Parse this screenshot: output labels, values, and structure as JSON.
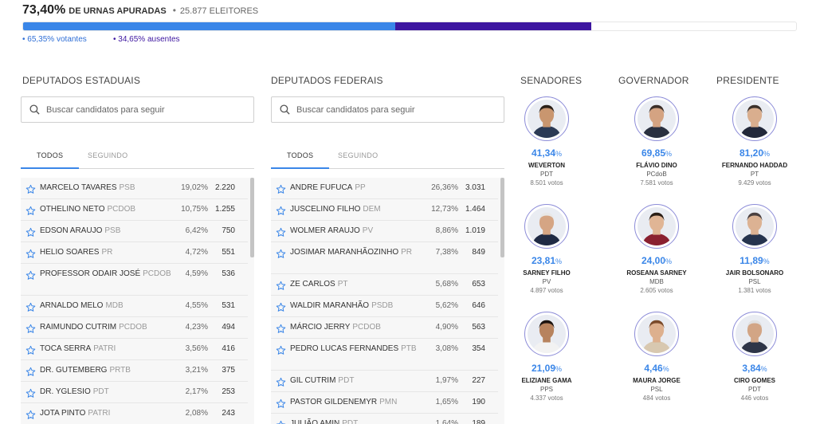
{
  "summary": {
    "pct_apuradas": "73,40%",
    "label_apuradas": "DE URNAS APURADAS",
    "separator": "•",
    "eleitores": "25.877 ELEITORES",
    "votantes": "• 65,35% votantes",
    "ausentes": "• 34,65% ausentes",
    "votantes_fraction": 0.4816,
    "ausentes_fraction": 0.2534,
    "colors": {
      "votantes": "#3a86e8",
      "ausentes": "#3d16a0",
      "accent": "#3a86e8"
    }
  },
  "estaduais": {
    "title": "DEPUTADOS ESTADUAIS",
    "search_placeholder": "Buscar candidatos para seguir",
    "tabs": [
      "TODOS",
      "SEGUINDO"
    ],
    "rows": [
      {
        "name": "MARCELO TAVARES",
        "party": "PSB",
        "pct": "19,02%",
        "votes": "2.220"
      },
      {
        "name": "OTHELINO NETO",
        "party": "PCdoB",
        "pct": "10,75%",
        "votes": "1.255"
      },
      {
        "name": "EDSON ARAUJO",
        "party": "PSB",
        "pct": "6,42%",
        "votes": "750"
      },
      {
        "name": "HELIO SOARES",
        "party": "PR",
        "pct": "4,72%",
        "votes": "551"
      },
      {
        "name": "PROFESSOR ODAIR JOSÉ",
        "party": "PCdoB",
        "pct": "4,59%",
        "votes": "536",
        "tall": true
      },
      {
        "name": "ARNALDO MELO",
        "party": "MDB",
        "pct": "4,55%",
        "votes": "531"
      },
      {
        "name": "RAIMUNDO CUTRIM",
        "party": "PCdoB",
        "pct": "4,23%",
        "votes": "494"
      },
      {
        "name": "TOCA SERRA",
        "party": "PATRI",
        "pct": "3,56%",
        "votes": "416"
      },
      {
        "name": "DR. GUTEMBERG",
        "party": "PRTB",
        "pct": "3,21%",
        "votes": "375"
      },
      {
        "name": "DR. YGLESIO",
        "party": "PDT",
        "pct": "2,17%",
        "votes": "253"
      },
      {
        "name": "JOTA PINTO",
        "party": "PATRI",
        "pct": "2,08%",
        "votes": "243"
      }
    ]
  },
  "federais": {
    "title": "DEPUTADOS FEDERAIS",
    "search_placeholder": "Buscar candidatos para seguir",
    "tabs": [
      "TODOS",
      "SEGUINDO"
    ],
    "rows": [
      {
        "name": "ANDRE FUFUCA",
        "party": "PP",
        "pct": "26,36%",
        "votes": "3.031"
      },
      {
        "name": "JUSCELINO FILHO",
        "party": "DEM",
        "pct": "12,73%",
        "votes": "1.464"
      },
      {
        "name": "WOLMER ARAUJO",
        "party": "PV",
        "pct": "8,86%",
        "votes": "1.019"
      },
      {
        "name": "JOSIMAR MARANHÃOZINHO",
        "party": "PR",
        "pct": "7,38%",
        "votes": "849",
        "tall": true
      },
      {
        "name": "ZE CARLOS",
        "party": "PT",
        "pct": "5,68%",
        "votes": "653"
      },
      {
        "name": "WALDIR MARANHÃO",
        "party": "PSDB",
        "pct": "5,62%",
        "votes": "646"
      },
      {
        "name": "MÁRCIO JERRY",
        "party": "PCdoB",
        "pct": "4,90%",
        "votes": "563"
      },
      {
        "name": "PEDRO LUCAS FERNANDES",
        "party": "PTB",
        "pct": "3,08%",
        "votes": "354",
        "tall": true
      },
      {
        "name": "GIL CUTRIM",
        "party": "PDT",
        "pct": "1,97%",
        "votes": "227"
      },
      {
        "name": "PASTOR GILDENEMYR",
        "party": "PMN",
        "pct": "1,65%",
        "votes": "190"
      },
      {
        "name": "JULIÃO AMIN",
        "party": "PDT",
        "pct": "1,64%",
        "votes": "189"
      }
    ]
  },
  "senadores": {
    "title": "SENADORES",
    "candidates": [
      {
        "pct": "41,34",
        "name": "WEVERTON",
        "party": "PDT",
        "votes": "8.501 votos",
        "skin": "#c9966f",
        "hair": "#2a2018",
        "shirt": "#2b3a55"
      },
      {
        "pct": "23,81",
        "name": "SARNEY FILHO",
        "party": "PV",
        "votes": "4.897 votos",
        "skin": "#d5a584",
        "hair": "#e8e8e8",
        "shirt": "#1f2a44"
      },
      {
        "pct": "21,09",
        "name": "ELIZIANE GAMA",
        "party": "PPS",
        "votes": "4.337 votos",
        "skin": "#b7835e",
        "hair": "#1c1410",
        "shirt": "#f2f2f2"
      }
    ]
  },
  "governador": {
    "title": "GOVERNADOR",
    "candidates": [
      {
        "pct": "69,85",
        "name": "FLÁVIO DINO",
        "party": "PCdoB",
        "votes": "7.581 votos",
        "skin": "#d4a382",
        "hair": "#3a2e28",
        "shirt": "#2a3040"
      },
      {
        "pct": "24,00",
        "name": "ROSEANA SARNEY",
        "party": "MDB",
        "votes": "2.605 votos",
        "skin": "#e0b595",
        "hair": "#2a1e16",
        "shirt": "#8a2030"
      },
      {
        "pct": "4,46",
        "name": "MAURA JORGE",
        "party": "PSL",
        "votes": "484 votos",
        "skin": "#ddb08e",
        "hair": "#7a4a2a",
        "shirt": "#d8c8b0"
      }
    ]
  },
  "presidente": {
    "title": "PRESIDENTE",
    "candidates": [
      {
        "pct": "81,20",
        "name": "FERNANDO HADDAD",
        "party": "PT",
        "votes": "9.429 votos",
        "skin": "#d9ae8e",
        "hair": "#3a302a",
        "shirt": "#22283a"
      },
      {
        "pct": "11,89",
        "name": "JAIR BOLSONARO",
        "party": "PSL",
        "votes": "1.381 votos",
        "skin": "#dcb293",
        "hair": "#4a4040",
        "shirt": "#26344e"
      },
      {
        "pct": "3,84",
        "name": "CIRO GOMES",
        "party": "PDT",
        "votes": "446 votos",
        "skin": "#d2a585",
        "hair": "#e0e0e0",
        "shirt": "#2e3548"
      }
    ]
  },
  "pct_symbol": "%"
}
